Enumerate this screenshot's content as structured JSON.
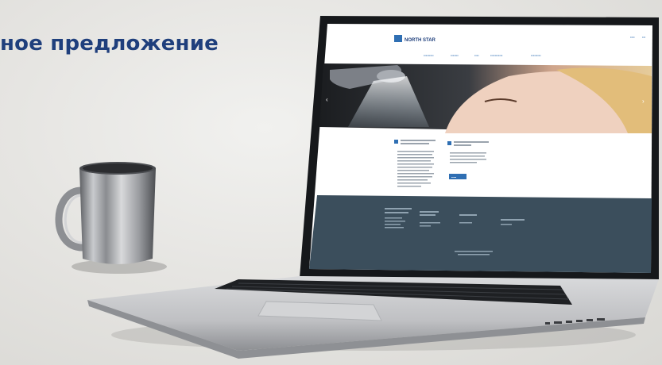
{
  "headline": "ное предложение",
  "colors": {
    "headline": "#1f3f7c",
    "background": "#e6e5e2",
    "laptop_body": "#c9cacc",
    "screen_footer": "#3b4e5c",
    "accent_blue": "#2f6fb3"
  },
  "screen": {
    "logo_text": "NORTH STAR",
    "top_links": [
      "••••",
      "•••"
    ],
    "nav_items": [
      "•••••••••",
      "•••••••",
      "••••",
      "•••••••••••",
      "•••••••••"
    ],
    "slider_arrow_left": "‹",
    "slider_arrow_right": "›",
    "button_label": "•••••"
  },
  "objects": {
    "mug": "steel-mug",
    "laptop": "silver-laptop"
  }
}
